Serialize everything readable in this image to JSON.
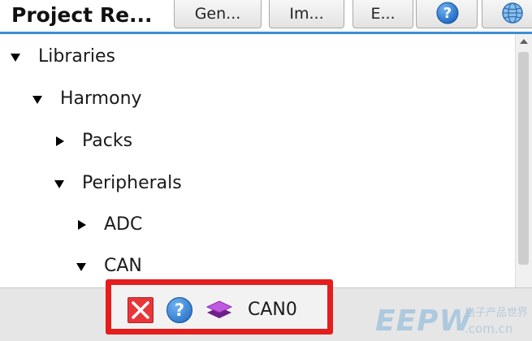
{
  "header": {
    "title": "Project Re...",
    "toolbar": [
      {
        "label": "Gen...",
        "type": "text"
      },
      {
        "label": "Im...",
        "type": "text"
      },
      {
        "label": "E...",
        "type": "text"
      },
      {
        "label": "",
        "type": "icon",
        "icon": "help-icon"
      },
      {
        "label": "",
        "type": "icon",
        "icon": "globe-icon"
      }
    ]
  },
  "tree": {
    "items": [
      {
        "label": "Libraries",
        "level": 0,
        "expanded": true
      },
      {
        "label": "Harmony",
        "level": 1,
        "expanded": true
      },
      {
        "label": "Packs",
        "level": 2,
        "expanded": false
      },
      {
        "label": "Peripherals",
        "level": 2,
        "expanded": true
      },
      {
        "label": "ADC",
        "level": 3,
        "expanded": false
      },
      {
        "label": "CAN",
        "level": 3,
        "expanded": true
      }
    ]
  },
  "component": {
    "label": "CAN0",
    "icons": [
      "remove-icon",
      "help-icon",
      "layers-icon"
    ]
  },
  "watermark": {
    "logo": "EEPW",
    "tagline": "电子产品世界",
    "url": ".com.cn"
  },
  "colors": {
    "accent": "#3b8fd6",
    "highlight": "#e41d1d",
    "remove": "#e8363a",
    "help": "#1d66c2",
    "layers": "#a43bc7"
  }
}
